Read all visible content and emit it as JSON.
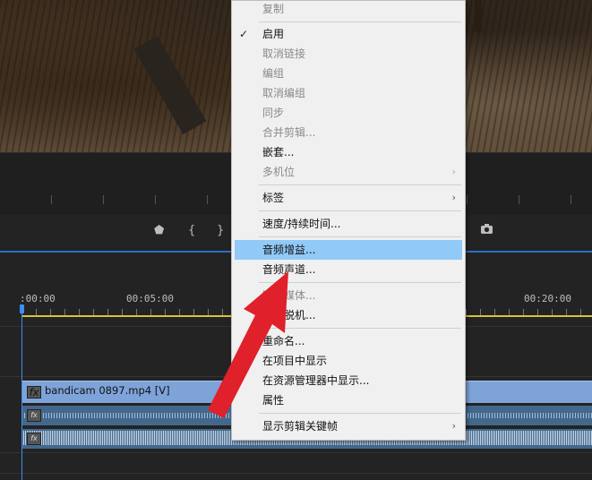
{
  "timeline": {
    "timecodes": [
      ":00:00",
      "00:05:00",
      "00:20:00"
    ],
    "video_clip_label": "bandicam 0897.mp4 [V]",
    "fx_label": "fx"
  },
  "menu": {
    "copy": "复制",
    "enable": "启用",
    "unlink": "取消链接",
    "group": "编组",
    "ungroup": "取消编组",
    "sync": "同步",
    "merge_clips": "合并剪辑...",
    "nest": "嵌套...",
    "multicam": "多机位",
    "label": "标签",
    "speed_duration": "速度/持续时间...",
    "audio_gain": "音频增益...",
    "audio_channels": "音频声道...",
    "link_media": "链接媒体...",
    "make_offline": "设为脱机...",
    "rename": "重命名...",
    "reveal_in_project": "在项目中显示",
    "reveal_in_explorer": "在资源管理器中显示...",
    "properties": "属性",
    "show_clip_keyframes": "显示剪辑关键帧"
  },
  "icons": {
    "checkmark": "✓",
    "submenu_arrow": "›"
  },
  "colors": {
    "highlight": "#91c9f7",
    "video_clip": "#7da3d9",
    "audio_clip": "#44688c",
    "playhead": "#3d8ef0",
    "arrow": "#e0202a"
  }
}
